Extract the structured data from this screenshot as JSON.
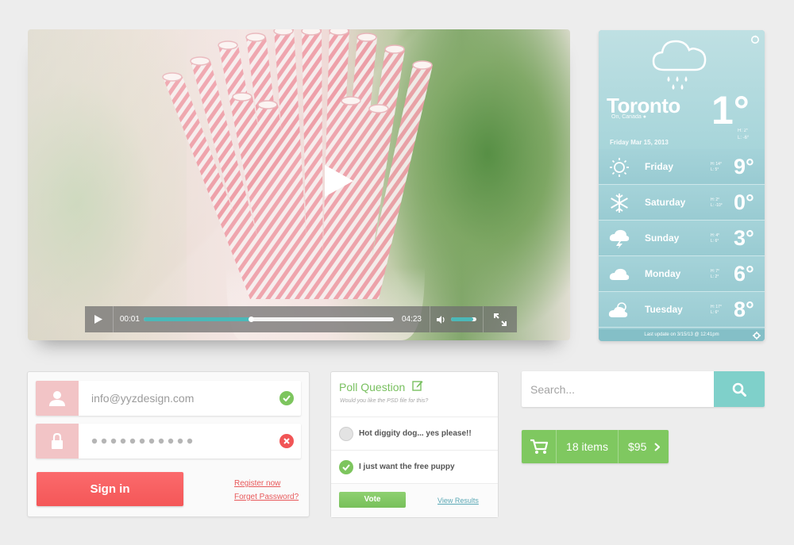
{
  "video": {
    "current_time": "00:01",
    "duration": "04:23",
    "progress": 0.43,
    "volume": 0.85
  },
  "weather": {
    "city": "Toronto",
    "region": "On, Canada",
    "date": "Friday Mar 15, 2013",
    "temp": "1°",
    "high": "H: 2°",
    "low": "L: -6°",
    "forecast": [
      {
        "day": "Friday",
        "high": "H: 14°",
        "low": "L: 5°",
        "temp": "9°",
        "icon": "sun-icon"
      },
      {
        "day": "Saturday",
        "high": "H: 2°",
        "low": "L: -10°",
        "temp": "0°",
        "icon": "snowflake-icon"
      },
      {
        "day": "Sunday",
        "high": "H: 4°",
        "low": "L: 6°",
        "temp": "3°",
        "icon": "thunderstorm-icon"
      },
      {
        "day": "Monday",
        "high": "H: 7°",
        "low": "L: 2°",
        "temp": "6°",
        "icon": "cloud-icon"
      },
      {
        "day": "Tuesday",
        "high": "H: 17°",
        "low": "L: 6°",
        "temp": "8°",
        "icon": "partly-cloudy-icon"
      }
    ],
    "footer": "Last update on 3/15/13 @ 12:41pm"
  },
  "login": {
    "email_value": "info@yyzdesign.com",
    "signin_label": "Sign in",
    "register_label": "Register now",
    "forgot_label": "Forget Password?"
  },
  "poll": {
    "title": "Poll Question",
    "subtitle": "Would you like the PSD file for this?",
    "options": [
      {
        "label": "Hot diggity dog... yes please!!",
        "selected": false
      },
      {
        "label": "I just want the free puppy",
        "selected": true
      }
    ],
    "vote_label": "Vote",
    "view_results_label": "View Results"
  },
  "search": {
    "placeholder": "Search..."
  },
  "cart": {
    "items_label": "18 items",
    "price": "$95"
  },
  "colors": {
    "accent_teal": "#7fd0ca",
    "accent_green": "#7fc860",
    "accent_red": "#f45758",
    "weather_blue": "#9ccdd4"
  }
}
